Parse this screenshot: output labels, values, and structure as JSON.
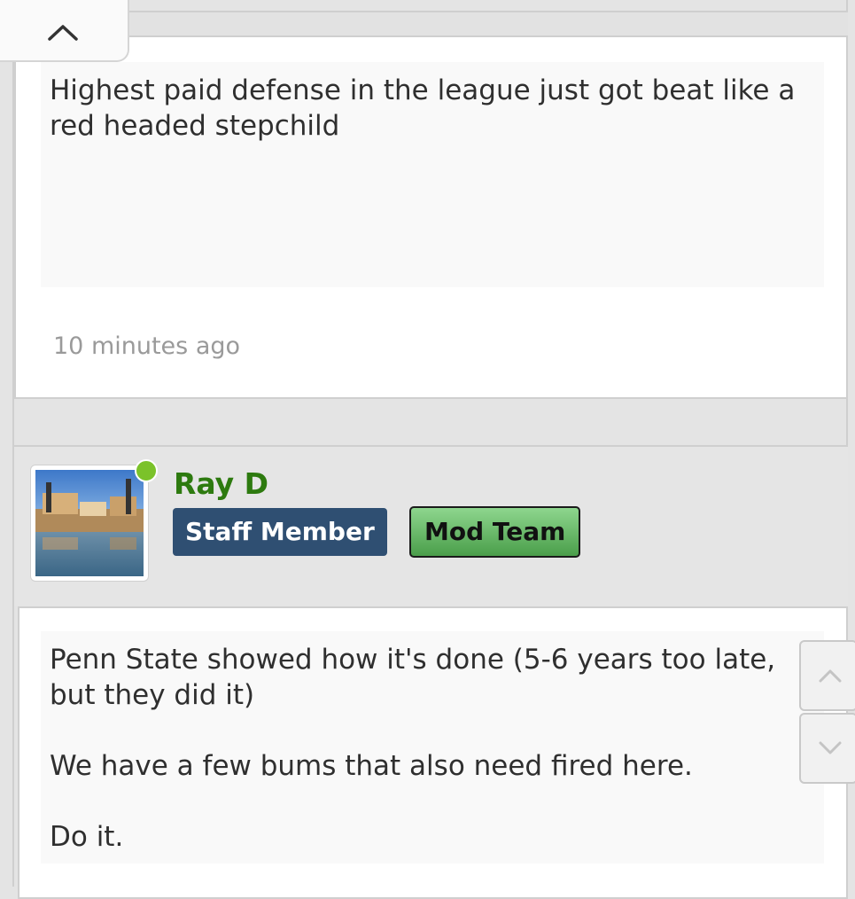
{
  "post1": {
    "message": "Highest paid defense in the league just got beat like a red headed stepchild",
    "timestamp": "10 minutes ago"
  },
  "post2": {
    "username": "Ray D",
    "badges": [
      "Staff Member",
      "Mod Team"
    ],
    "message": "Penn State showed how it's done (5-6 years too late, but they did it)\n\nWe have a few bums that also need fired here.\n\nDo it.",
    "online": true
  },
  "icons": {
    "collapse": "chevron-up-icon",
    "scroll_up": "chevron-up-icon",
    "scroll_down": "chevron-down-icon"
  },
  "colors": {
    "username": "#2d7a0f",
    "staff_badge": "#2f4f72",
    "mod_badge": "#5fb25f",
    "online_dot": "#7bc22a"
  }
}
